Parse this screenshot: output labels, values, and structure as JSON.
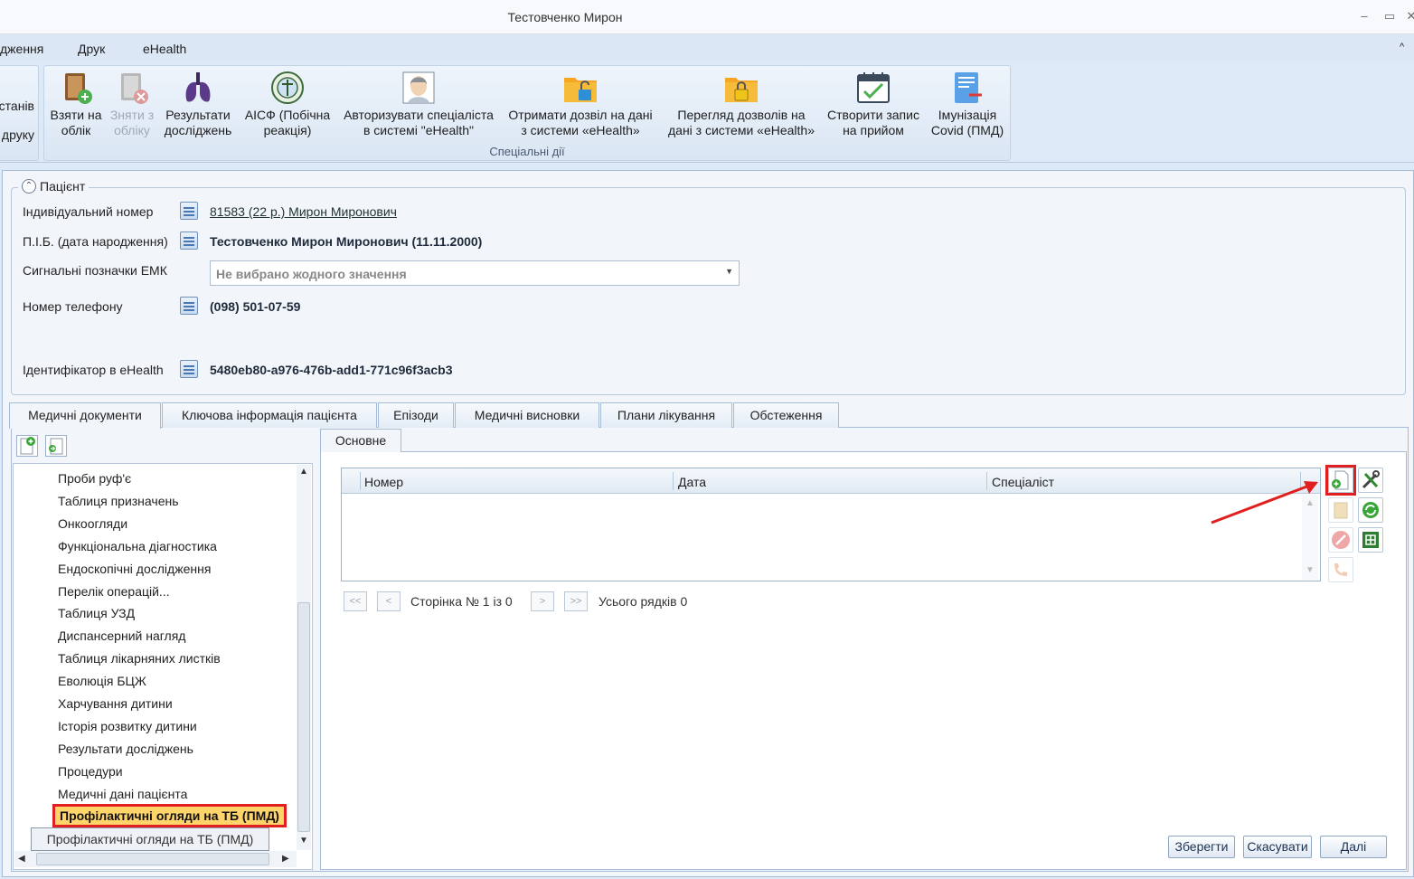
{
  "window": {
    "title": "Тестовченко Мирон",
    "minimize_glyph": "–",
    "restore_glyph": "▭",
    "close_glyph": "✕",
    "help_glyph": "^"
  },
  "menu": {
    "items": [
      "дження",
      "Друк",
      "eHealth"
    ]
  },
  "ribbon": {
    "left_partial": [
      "станів",
      "друку"
    ],
    "group_label": "Спеціальні дії",
    "buttons": [
      {
        "label1": "Взяти на",
        "label2": "облік",
        "icon": "book-add-icon",
        "enabled": true
      },
      {
        "label1": "Зняти з",
        "label2": "обліку",
        "icon": "book-remove-icon",
        "enabled": false
      },
      {
        "label1": "Результати",
        "label2": "досліджень",
        "icon": "lungs-icon",
        "enabled": true
      },
      {
        "label1": "АІСФ (Побічна",
        "label2": "реакція)",
        "icon": "pharma-emblem-icon",
        "enabled": true
      },
      {
        "label1": "Авторизувати спеціаліста",
        "label2": "в системі \"eHealth\"",
        "icon": "doctor-avatar-icon",
        "enabled": true
      },
      {
        "label1": "Отримати дозвіл на дані",
        "label2": "з системи «eHealth»",
        "icon": "folder-unlock-icon",
        "enabled": true
      },
      {
        "label1": "Перегляд дозволів на",
        "label2": "дані з системи «eHealth»",
        "icon": "folder-lock-icon",
        "enabled": true
      },
      {
        "label1": "Створити запис",
        "label2": "на прийом",
        "icon": "calendar-check-icon",
        "enabled": true
      },
      {
        "label1": "Імунізація",
        "label2": "Covid (ПМД)",
        "icon": "document-arrow-icon",
        "enabled": true
      }
    ]
  },
  "patient": {
    "legend": "Пацієнт",
    "fields": {
      "id_label": "Індивідуальний номер",
      "id_value": "81583 (22 р.) Мирон Миронович",
      "name_label": "П.І.Б. (дата народження)",
      "name_value": "Тестовченко Мирон Миронович (11.11.2000)",
      "signals_label": "Сигнальні позначки ЕМК",
      "signals_placeholder": "Не вибрано жодного значення",
      "phone_label": "Номер телефону",
      "phone_value": "(098) 501-07-59",
      "ehealth_label": "Ідентифікатор в eHealth",
      "ehealth_value": "5480eb80-a976-476b-add1-771c96f3acb3"
    }
  },
  "tabs": [
    "Медичні документи",
    "Ключова інформація пацієнта",
    "Епізоди",
    "Медичні висновки",
    "Плани лікування",
    "Обстеження"
  ],
  "active_tab": "Медичні документи",
  "tree": {
    "items": [
      "Проби руф'є",
      "Таблиця призначень",
      "Онкоогляди",
      "Функціональна діагностика",
      "Ендоскопічні дослідження",
      "Перелік операцій...",
      "Таблиця УЗД",
      "Диспансерний нагляд",
      "Таблиця лікарняних листків",
      "Еволюція БЦЖ",
      "Харчування дитини",
      "Історія розвитку дитини",
      "Результати досліджень",
      "Процедури",
      "Медичні дані пацієнта"
    ],
    "selected": "Профілактичні огляди на ТБ (ПМД)",
    "tooltip": "Профілактичні огляди на ТБ (ПМД)"
  },
  "detail": {
    "subtab": "Основне",
    "columns": [
      "Номер",
      "Дата",
      "Спеціаліст"
    ],
    "pager": {
      "first": "<<",
      "prev": "<",
      "next": ">",
      "last": ">>",
      "page_text": "Сторінка № 1 із 0",
      "rows_text": "Усього рядків 0"
    },
    "side_buttons": [
      "add-document-icon",
      "tools-icon",
      "book-icon",
      "refresh-icon",
      "cancel-icon",
      "excel-export-icon",
      "phone-icon"
    ]
  },
  "footer": {
    "save": "Зберегти",
    "cancel": "Скасувати",
    "next": "Далі"
  },
  "colors": {
    "highlight_border": "#e02020",
    "selected_bg": "#ffd56b",
    "ribbon_bg": "#dde9f6"
  }
}
